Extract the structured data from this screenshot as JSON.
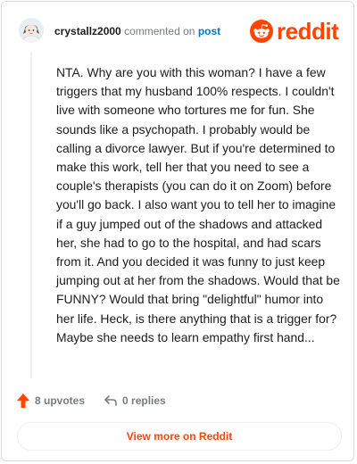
{
  "comment": {
    "author": "crystallz2000",
    "action_text": "commented on",
    "post_link": "post",
    "body": "NTA. Why are you with this woman? I have a few triggers that my husband 100% respects. I couldn't live with someone who tortures me for fun. She sounds like a psychopath. I probably would be calling a divorce lawyer. But if you're determined to make this work, tell her that you need to see a couple's therapists (you can do it on Zoom) before you'll go back. I also want you to tell her to imagine if a guy jumped out of the shadows and attacked her, she had to go to the hospital, and had scars from it. And you decided it was funny to just keep jumping out at her from the shadows. Would that be FUNNY? Would that bring \"delightful\" humor into her life. Heck, is there anything that is a trigger for? Maybe she needs to learn empathy first hand..."
  },
  "brand": {
    "wordmark": "reddit",
    "color": "#ff4500"
  },
  "actions": {
    "upvotes": "8 upvotes",
    "replies": "0 replies",
    "upvote_icon": "arrow-up-icon",
    "reply_icon": "reply-arrow-icon"
  },
  "footer": {
    "view_more": "View more on Reddit"
  }
}
